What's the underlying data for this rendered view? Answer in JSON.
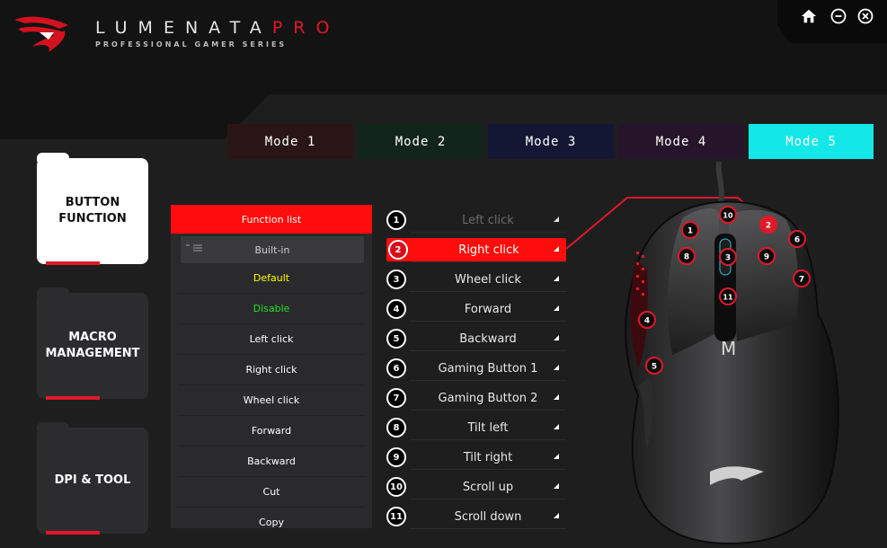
{
  "header": {
    "brand_main": "LUMENATA",
    "brand_pro": "PRO",
    "tagline": "PROFESSIONAL GAMER SERIES",
    "controls": [
      {
        "name": "home-icon"
      },
      {
        "name": "minimize-icon"
      },
      {
        "name": "close-icon"
      }
    ]
  },
  "modes": [
    {
      "label": "Mode 1",
      "color": "#2a1516"
    },
    {
      "label": "Mode 2",
      "color": "#12251a"
    },
    {
      "label": "Mode 3",
      "color": "#131734"
    },
    {
      "label": "Mode 4",
      "color": "#26142a"
    },
    {
      "label": "Mode 5",
      "color": "#13e7e7"
    }
  ],
  "nav": {
    "button_function": "BUTTON FUNCTION",
    "macro_management": "MACRO MANAGEMENT",
    "dpi_tool": "DPI & TOOL"
  },
  "function_list": {
    "header": "Function list",
    "builtin": "Built-in",
    "items": [
      {
        "label": "Default",
        "color": "#ffff00"
      },
      {
        "label": "Disable",
        "color": "#22e022"
      },
      {
        "label": "Left click",
        "color": "#ffffff"
      },
      {
        "label": "Right click",
        "color": "#ffffff"
      },
      {
        "label": "Wheel click",
        "color": "#ffffff"
      },
      {
        "label": "Forward",
        "color": "#ffffff"
      },
      {
        "label": "Backward",
        "color": "#ffffff"
      },
      {
        "label": "Cut",
        "color": "#ffffff"
      },
      {
        "label": "Copy",
        "color": "#ffffff"
      }
    ]
  },
  "buttons": [
    {
      "num": "1",
      "label": "Left click"
    },
    {
      "num": "2",
      "label": "Right click"
    },
    {
      "num": "3",
      "label": "Wheel click"
    },
    {
      "num": "4",
      "label": "Forward"
    },
    {
      "num": "5",
      "label": "Backward"
    },
    {
      "num": "6",
      "label": "Gaming Button 1"
    },
    {
      "num": "7",
      "label": "Gaming Button 2"
    },
    {
      "num": "8",
      "label": "Tilt left"
    },
    {
      "num": "9",
      "label": "Tilt right"
    },
    {
      "num": "10",
      "label": "Scroll up"
    },
    {
      "num": "11",
      "label": "Scroll down"
    }
  ],
  "mouse_markers": [
    "1",
    "2",
    "3",
    "4",
    "5",
    "6",
    "7",
    "8",
    "9",
    "10",
    "11"
  ],
  "mouse_glyph": "M",
  "colors": {
    "accent": "#ff0c0c",
    "active_mode": "#13e7e7"
  }
}
